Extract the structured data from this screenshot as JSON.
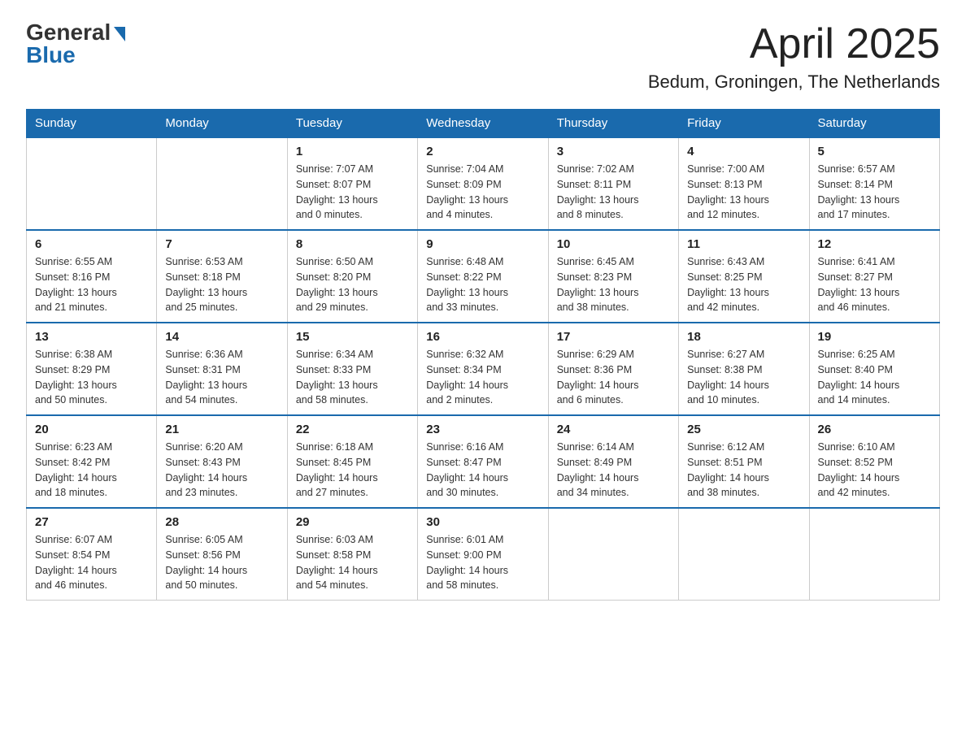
{
  "logo": {
    "general": "General",
    "blue": "Blue"
  },
  "header": {
    "month": "April 2025",
    "location": "Bedum, Groningen, The Netherlands"
  },
  "days_of_week": [
    "Sunday",
    "Monday",
    "Tuesday",
    "Wednesday",
    "Thursday",
    "Friday",
    "Saturday"
  ],
  "weeks": [
    [
      {
        "day": "",
        "details": ""
      },
      {
        "day": "",
        "details": ""
      },
      {
        "day": "1",
        "details": "Sunrise: 7:07 AM\nSunset: 8:07 PM\nDaylight: 13 hours\nand 0 minutes."
      },
      {
        "day": "2",
        "details": "Sunrise: 7:04 AM\nSunset: 8:09 PM\nDaylight: 13 hours\nand 4 minutes."
      },
      {
        "day": "3",
        "details": "Sunrise: 7:02 AM\nSunset: 8:11 PM\nDaylight: 13 hours\nand 8 minutes."
      },
      {
        "day": "4",
        "details": "Sunrise: 7:00 AM\nSunset: 8:13 PM\nDaylight: 13 hours\nand 12 minutes."
      },
      {
        "day": "5",
        "details": "Sunrise: 6:57 AM\nSunset: 8:14 PM\nDaylight: 13 hours\nand 17 minutes."
      }
    ],
    [
      {
        "day": "6",
        "details": "Sunrise: 6:55 AM\nSunset: 8:16 PM\nDaylight: 13 hours\nand 21 minutes."
      },
      {
        "day": "7",
        "details": "Sunrise: 6:53 AM\nSunset: 8:18 PM\nDaylight: 13 hours\nand 25 minutes."
      },
      {
        "day": "8",
        "details": "Sunrise: 6:50 AM\nSunset: 8:20 PM\nDaylight: 13 hours\nand 29 minutes."
      },
      {
        "day": "9",
        "details": "Sunrise: 6:48 AM\nSunset: 8:22 PM\nDaylight: 13 hours\nand 33 minutes."
      },
      {
        "day": "10",
        "details": "Sunrise: 6:45 AM\nSunset: 8:23 PM\nDaylight: 13 hours\nand 38 minutes."
      },
      {
        "day": "11",
        "details": "Sunrise: 6:43 AM\nSunset: 8:25 PM\nDaylight: 13 hours\nand 42 minutes."
      },
      {
        "day": "12",
        "details": "Sunrise: 6:41 AM\nSunset: 8:27 PM\nDaylight: 13 hours\nand 46 minutes."
      }
    ],
    [
      {
        "day": "13",
        "details": "Sunrise: 6:38 AM\nSunset: 8:29 PM\nDaylight: 13 hours\nand 50 minutes."
      },
      {
        "day": "14",
        "details": "Sunrise: 6:36 AM\nSunset: 8:31 PM\nDaylight: 13 hours\nand 54 minutes."
      },
      {
        "day": "15",
        "details": "Sunrise: 6:34 AM\nSunset: 8:33 PM\nDaylight: 13 hours\nand 58 minutes."
      },
      {
        "day": "16",
        "details": "Sunrise: 6:32 AM\nSunset: 8:34 PM\nDaylight: 14 hours\nand 2 minutes."
      },
      {
        "day": "17",
        "details": "Sunrise: 6:29 AM\nSunset: 8:36 PM\nDaylight: 14 hours\nand 6 minutes."
      },
      {
        "day": "18",
        "details": "Sunrise: 6:27 AM\nSunset: 8:38 PM\nDaylight: 14 hours\nand 10 minutes."
      },
      {
        "day": "19",
        "details": "Sunrise: 6:25 AM\nSunset: 8:40 PM\nDaylight: 14 hours\nand 14 minutes."
      }
    ],
    [
      {
        "day": "20",
        "details": "Sunrise: 6:23 AM\nSunset: 8:42 PM\nDaylight: 14 hours\nand 18 minutes."
      },
      {
        "day": "21",
        "details": "Sunrise: 6:20 AM\nSunset: 8:43 PM\nDaylight: 14 hours\nand 23 minutes."
      },
      {
        "day": "22",
        "details": "Sunrise: 6:18 AM\nSunset: 8:45 PM\nDaylight: 14 hours\nand 27 minutes."
      },
      {
        "day": "23",
        "details": "Sunrise: 6:16 AM\nSunset: 8:47 PM\nDaylight: 14 hours\nand 30 minutes."
      },
      {
        "day": "24",
        "details": "Sunrise: 6:14 AM\nSunset: 8:49 PM\nDaylight: 14 hours\nand 34 minutes."
      },
      {
        "day": "25",
        "details": "Sunrise: 6:12 AM\nSunset: 8:51 PM\nDaylight: 14 hours\nand 38 minutes."
      },
      {
        "day": "26",
        "details": "Sunrise: 6:10 AM\nSunset: 8:52 PM\nDaylight: 14 hours\nand 42 minutes."
      }
    ],
    [
      {
        "day": "27",
        "details": "Sunrise: 6:07 AM\nSunset: 8:54 PM\nDaylight: 14 hours\nand 46 minutes."
      },
      {
        "day": "28",
        "details": "Sunrise: 6:05 AM\nSunset: 8:56 PM\nDaylight: 14 hours\nand 50 minutes."
      },
      {
        "day": "29",
        "details": "Sunrise: 6:03 AM\nSunset: 8:58 PM\nDaylight: 14 hours\nand 54 minutes."
      },
      {
        "day": "30",
        "details": "Sunrise: 6:01 AM\nSunset: 9:00 PM\nDaylight: 14 hours\nand 58 minutes."
      },
      {
        "day": "",
        "details": ""
      },
      {
        "day": "",
        "details": ""
      },
      {
        "day": "",
        "details": ""
      }
    ]
  ]
}
